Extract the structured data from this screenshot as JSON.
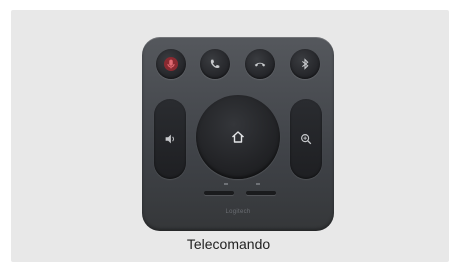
{
  "product": {
    "caption": "Telecomando",
    "brand_text": "Logitech"
  },
  "icons": {
    "mute": "microphone-mute-icon",
    "call": "phone-call-icon",
    "hangup": "phone-hangup-icon",
    "bluetooth": "bluetooth-icon",
    "volume": "speaker-icon",
    "home": "home-icon",
    "zoom": "zoom-in-icon"
  },
  "colors": {
    "background": "#e8e8e8",
    "remote_body": "#4a4d52",
    "mute_accent": "#b0323a",
    "icon_light": "#c8cacd"
  }
}
